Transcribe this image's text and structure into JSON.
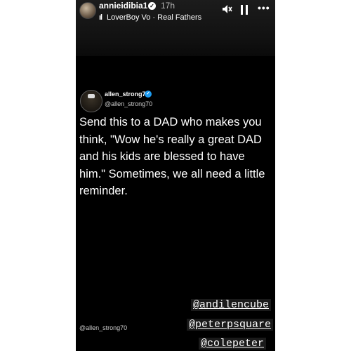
{
  "story": {
    "username": "annieidibia1",
    "time": "17h",
    "music": {
      "icon": "music-bars-icon",
      "text": "LoverBoy Vo · Real Fathers"
    },
    "controls": [
      "mute-icon",
      "pause-icon",
      "more-icon"
    ]
  },
  "tweet": {
    "display_name": "allen_strong70",
    "handle": "@allen_strong70",
    "body": "Send this to a DAD who makes you think, \"Wow he's really a great DAD and his kids are blessed to have him.\" Sometimes, we all need a little reminder."
  },
  "watermark": "@allen_strong70",
  "mentions": [
    "@andilencube",
    "@peterpsquare",
    "@colepeter"
  ],
  "colors": {
    "background": "#000000",
    "verified_blue": "#1d9bf0",
    "text": "#ffffff"
  }
}
